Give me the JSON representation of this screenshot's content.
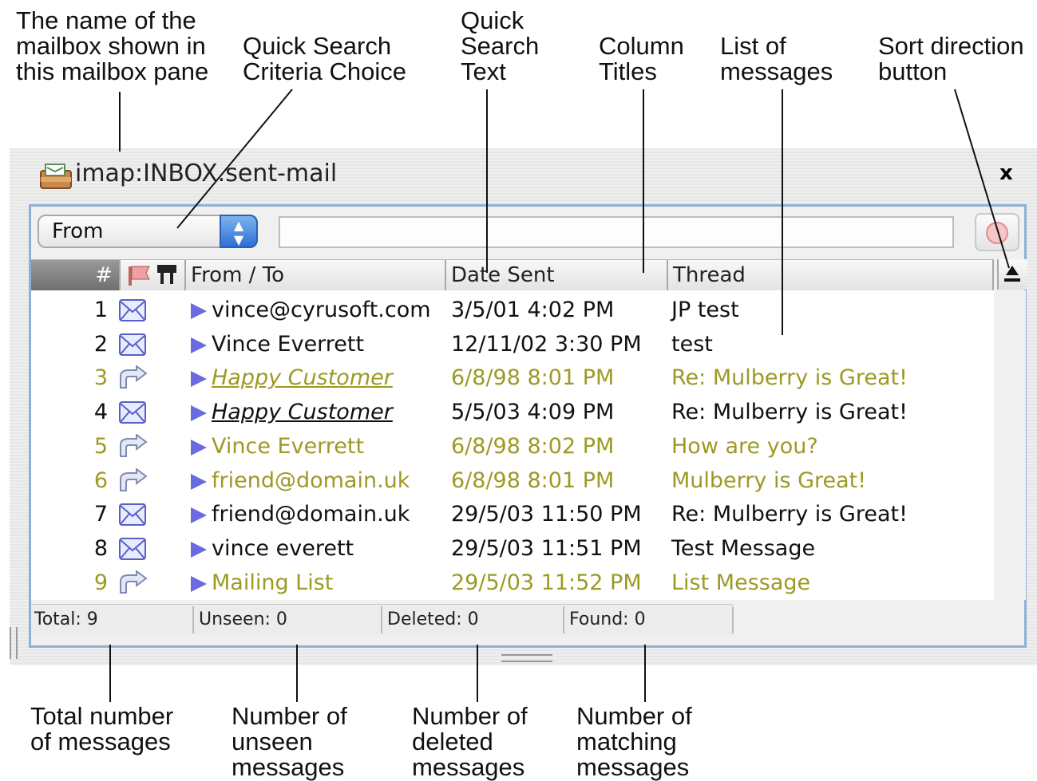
{
  "callouts": {
    "mailbox_name": [
      "The name of the",
      "mailbox shown in",
      "this mailbox pane"
    ],
    "criteria": [
      "Quick Search",
      "Criteria Choice"
    ],
    "search_text": [
      "Quick",
      "Search",
      "Text"
    ],
    "column_titles": [
      "Column",
      "Titles"
    ],
    "list_messages": [
      "List of",
      "messages"
    ],
    "sort_direction": [
      "Sort direction",
      "button"
    ],
    "total": [
      "Total number",
      "of messages"
    ],
    "unseen": [
      "Number of",
      "unseen",
      "messages"
    ],
    "deleted": [
      "Number of",
      "deleted",
      "messages"
    ],
    "matching": [
      "Number of",
      "matching",
      "messages"
    ]
  },
  "window": {
    "title": "imap:INBOX.sent-mail",
    "close_label": "x",
    "icon": "mailbox-icon"
  },
  "search": {
    "criteria_selected": "From",
    "text_value": ""
  },
  "columns": {
    "number": "#",
    "from_to": "From / To",
    "date_sent": "Date Sent",
    "thread": "Thread"
  },
  "messages": [
    {
      "num": "1",
      "icon": "envelope-icon",
      "from": "vince@cyrusoft.com",
      "date": "3/5/01 4:02 PM",
      "thread": "JP test",
      "style": "black",
      "emphasis": false
    },
    {
      "num": "2",
      "icon": "envelope-icon",
      "from": "Vince Everrett",
      "date": "12/11/02 3:30 PM",
      "thread": "test",
      "style": "black",
      "emphasis": false
    },
    {
      "num": "3",
      "icon": "reply-icon",
      "from": "Happy Customer",
      "date": "6/8/98 8:01 PM",
      "thread": "Re: Mulberry is Great!",
      "style": "olive",
      "emphasis": true
    },
    {
      "num": "4",
      "icon": "envelope-icon",
      "from": "Happy Customer",
      "date": "5/5/03 4:09 PM",
      "thread": "Re: Mulberry is Great!",
      "style": "black",
      "emphasis": true
    },
    {
      "num": "5",
      "icon": "reply-icon",
      "from": "Vince Everrett",
      "date": "6/8/98 8:02 PM",
      "thread": "How are you?",
      "style": "olive",
      "emphasis": false
    },
    {
      "num": "6",
      "icon": "reply-icon",
      "from": "friend@domain.uk",
      "date": "6/8/98 8:01 PM",
      "thread": "Mulberry is Great!",
      "style": "olive",
      "emphasis": false
    },
    {
      "num": "7",
      "icon": "envelope-icon",
      "from": "friend@domain.uk",
      "date": "29/5/03 11:50 PM",
      "thread": "Re: Mulberry is Great!",
      "style": "black",
      "emphasis": false
    },
    {
      "num": "8",
      "icon": "envelope-icon",
      "from": "vince everett",
      "date": "29/5/03 11:51 PM",
      "thread": "Test Message",
      "style": "black",
      "emphasis": false
    },
    {
      "num": "9",
      "icon": "reply-icon",
      "from": "Mailing List",
      "date": "29/5/03 11:52 PM",
      "thread": "List Message",
      "style": "olive",
      "emphasis": false
    }
  ],
  "status": {
    "total": "Total:  9",
    "unseen": "Unseen:  0",
    "deleted": "Deleted: 0",
    "found": "Found:  0"
  },
  "colors": {
    "olive": "#9c9a25",
    "pane_border": "#8eb0d8",
    "arrow": "#6a6be0"
  }
}
